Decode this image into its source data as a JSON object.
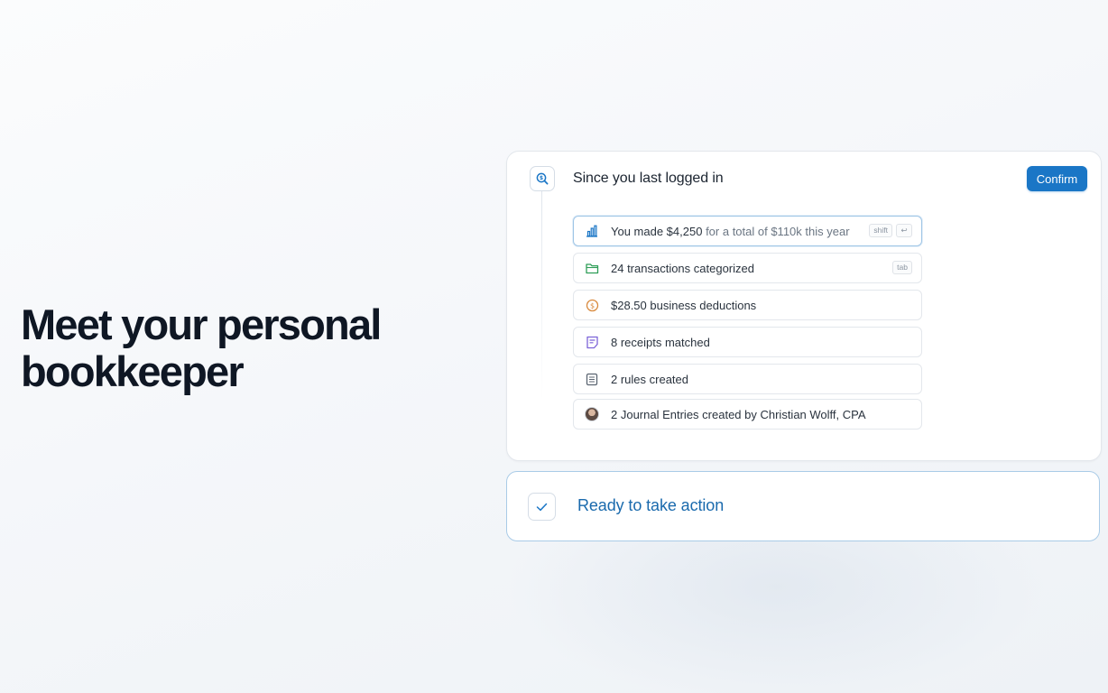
{
  "hero": {
    "line1": "Meet your personal",
    "line2": "bookkeeper"
  },
  "summary_card": {
    "icon": "search-dollar-icon",
    "title": "Since you last logged in",
    "confirm_label": "Confirm",
    "items": [
      {
        "icon": "bar-chart-icon",
        "text_main": "You made $4,250",
        "text_muted": " for a total of $110k this year",
        "shortcut": "shift",
        "shortcut2": "↩"
      },
      {
        "icon": "folder-icon",
        "text_main": "24 transactions categorized",
        "shortcut": "tab"
      },
      {
        "icon": "dollar-circle-icon",
        "text_main": "$28.50 business deductions"
      },
      {
        "icon": "receipt-icon",
        "text_main": "8 receipts matched"
      },
      {
        "icon": "rules-list-icon",
        "text_main": "2 rules created"
      },
      {
        "icon": "avatar",
        "text_main": "2 Journal Entries created by Christian Wolff, CPA"
      }
    ]
  },
  "action_card": {
    "icon": "check-icon",
    "text": "Ready to take action"
  },
  "colors": {
    "accent": "#1a76c6",
    "action_text": "#1a6aad",
    "folder_green": "#2f9e58",
    "coin_orange": "#d98a3e",
    "receipt_purple": "#7c63d8"
  }
}
